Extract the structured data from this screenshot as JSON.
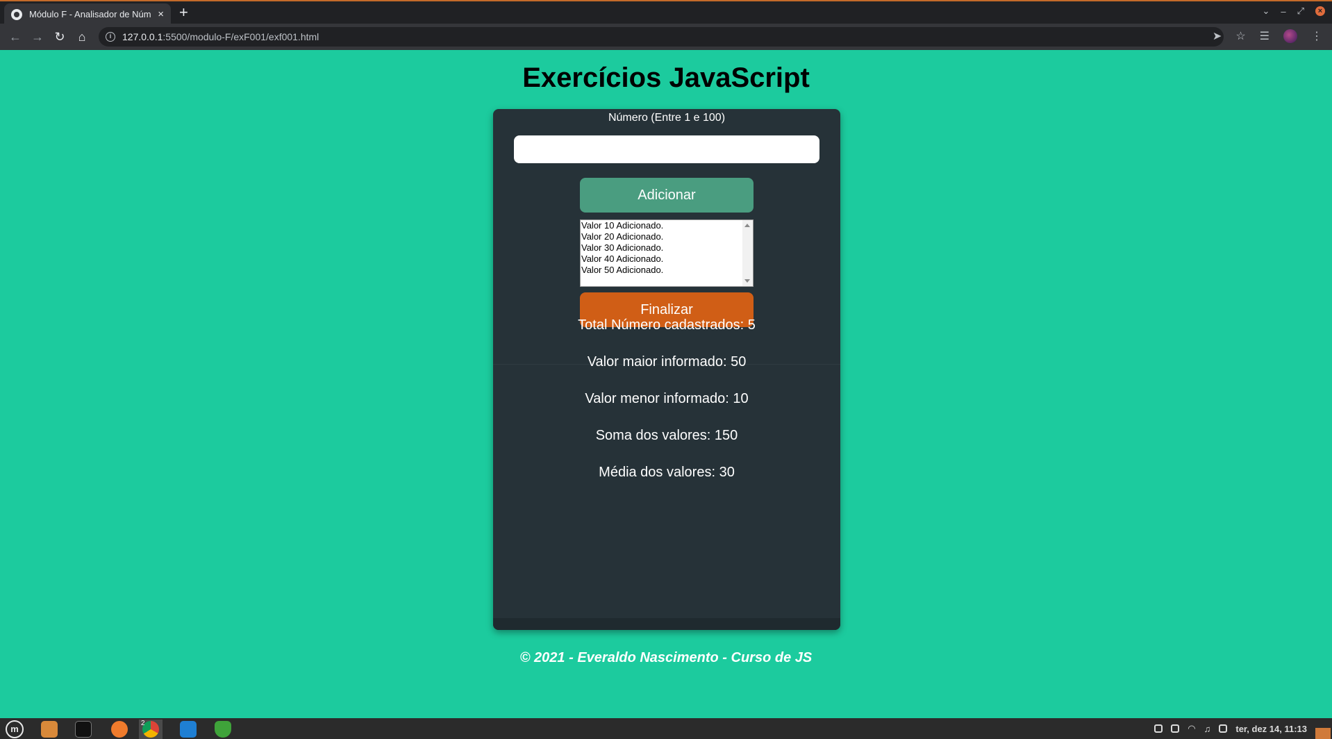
{
  "browser": {
    "tab_title": "Módulo F - Analisador de Núm",
    "tab_close": "×",
    "new_tab": "+",
    "url_host": "127.0.0.1",
    "url_path": ":5500/modulo-F/exF001/exf001.html",
    "icons": [
      "back-icon",
      "forward-icon",
      "reload-icon",
      "home-icon",
      "info-icon",
      "send-icon",
      "star-icon",
      "reading-list-icon",
      "profile-avatar",
      "more-icon"
    ]
  },
  "page": {
    "title": "Exercícios JavaScript",
    "input_label": "Número (Entre 1 e 100)",
    "input_value": "",
    "add_button": "Adicionar",
    "finish_button": "Finalizar",
    "list_items": [
      "Valor 10 Adicionado.",
      "Valor 20 Adicionado.",
      "Valor 30 Adicionado.",
      "Valor 40 Adicionado.",
      "Valor 50 Adicionado."
    ],
    "results": {
      "total": "Total Número cadastrados: 5",
      "max": "Valor maior informado: 50",
      "min": "Valor menor informado: 10",
      "sum": "Soma dos valores: 150",
      "avg": "Média dos valores: 30"
    },
    "footer": "© 2021 - Everaldo Nascimento - Curso de JS"
  },
  "colors": {
    "page_bg": "#1ccb9e",
    "card_bg": "#263238",
    "add_button": "#4a9d80",
    "finish_button": "#d05e16"
  },
  "taskbar": {
    "clock": "ter, dez 14, 11:13",
    "chrome_badge": "2",
    "apps": [
      "menu-icon",
      "files-icon",
      "terminal-icon",
      "firefox-icon",
      "chrome-icon",
      "vscode-icon",
      "shield-app-icon"
    ]
  }
}
